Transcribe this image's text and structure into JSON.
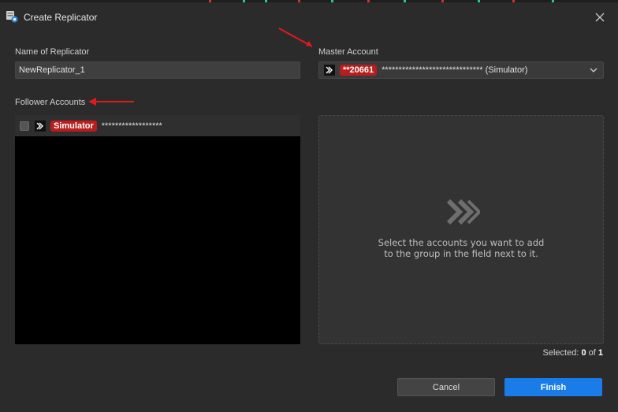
{
  "window": {
    "title": "Create Replicator"
  },
  "name_field": {
    "label": "Name of Replicator",
    "value": "NewReplicator_1"
  },
  "master": {
    "label": "Master Account",
    "badge": "**20661",
    "masked": "****************************** (Simulator)"
  },
  "followers": {
    "label": "Follower Accounts",
    "items": [
      {
        "badge": "Simulator",
        "masked": "******************"
      }
    ]
  },
  "dropzone": {
    "line1": "Select the accounts you want to add",
    "line2": "to the group in the field next to it."
  },
  "selected": {
    "prefix": "Selected:",
    "count": "0",
    "of": "of",
    "total": "1"
  },
  "buttons": {
    "cancel": "Cancel",
    "finish": "Finish"
  },
  "colors": {
    "accent": "#1a7ce8",
    "badge": "#b91d1d",
    "annotation": "#e01b1b"
  }
}
